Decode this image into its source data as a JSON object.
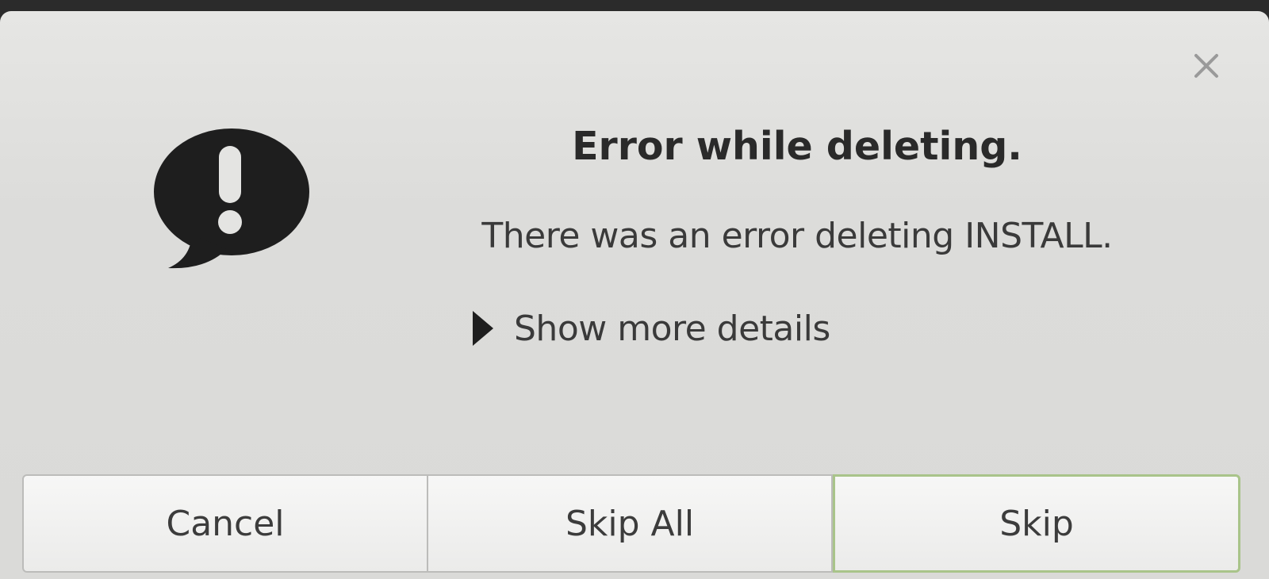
{
  "dialog": {
    "title": "Error while deleting.",
    "message": "There was an error deleting INSTALL.",
    "details_toggle_label": "Show more details",
    "icons": {
      "close": "close-icon",
      "main": "error-speech-bubble-icon",
      "expander": "triangle-right-icon"
    },
    "buttons": {
      "cancel": "Cancel",
      "skip_all": "Skip All",
      "skip": "Skip"
    },
    "colors": {
      "dialog_background": "#dcdcda",
      "default_button_border": "#a9c48a",
      "icon": "#1e1e1e"
    }
  }
}
